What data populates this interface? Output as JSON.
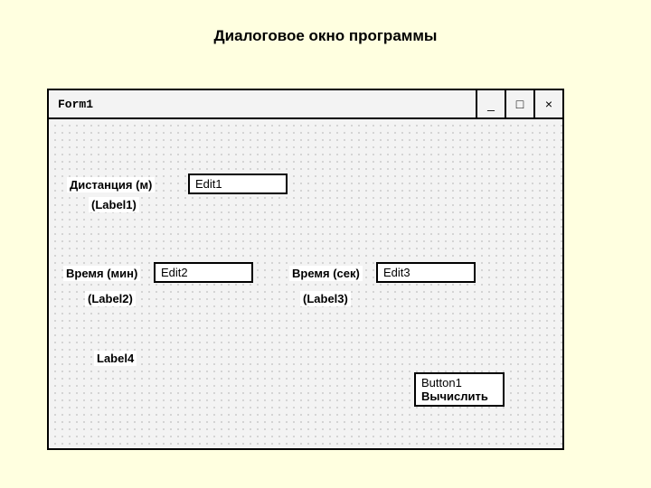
{
  "page": {
    "heading": "Диалоговое окно программы"
  },
  "window": {
    "title": "Form1",
    "controls": {
      "minimize": "_",
      "maximize": "□",
      "close": "×"
    }
  },
  "labels": {
    "distance": "Дистанция (м)",
    "distance_id": "(Label1)",
    "time_min": "Время (мин)",
    "time_min_id": "(Label2)",
    "time_sec": "Время (сек)",
    "time_sec_id": "(Label3)",
    "output": "Label4"
  },
  "edits": {
    "e1": "Edit1",
    "e2": "Edit2",
    "e3": "Edit3"
  },
  "button": {
    "name": "Button1",
    "caption": "Вычислить"
  }
}
